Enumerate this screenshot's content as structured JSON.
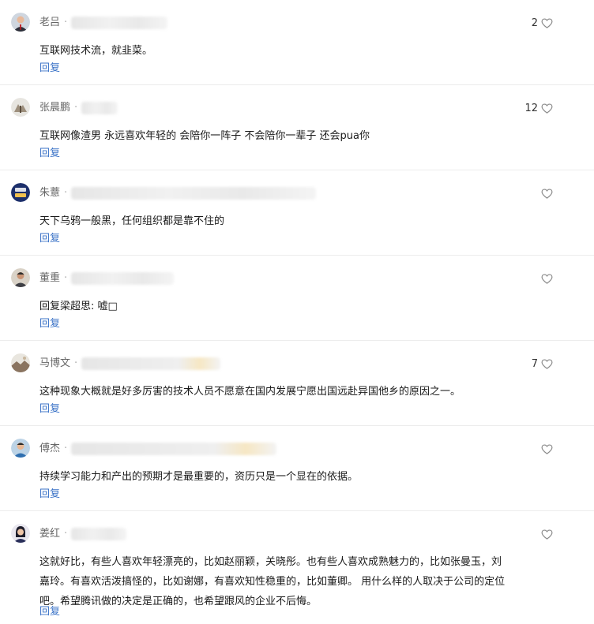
{
  "reply_label": "回复",
  "comments": [
    {
      "name": "老吕",
      "likes": "2",
      "text": "互联网技术流，就韭菜。",
      "avatar": "man-red-tie"
    },
    {
      "name": "张晨鹏",
      "likes": "12",
      "text": "互联网像渣男 永远喜欢年轻的 会陪你一阵子 不会陪你一辈子 还会pua你",
      "avatar": "snow-scene"
    },
    {
      "name": "朱薏",
      "likes": "",
      "text": "天下乌鸦一般黑，任何组织都是靠不住的",
      "avatar": "badge-logo"
    },
    {
      "name": "董重",
      "likes": "",
      "text": "回复梁超思: 嘘□",
      "avatar": "man-portrait"
    },
    {
      "name": "马博文",
      "likes": "7",
      "text": "这种现象大概就是好多厉害的技术人员不愿意在国内发展宁愿出国远赴异国他乡的原因之一。",
      "avatar": "landscape"
    },
    {
      "name": "傅杰",
      "likes": "",
      "text": "持续学习能力和产出的预期才是最重要的，资历只是一个显在的依据。",
      "avatar": "man-blue"
    },
    {
      "name": "姜红",
      "likes": "",
      "text": "这就好比，有些人喜欢年轻漂亮的，比如赵丽颖，关晓彤。也有些人喜欢成熟魅力的，比如张曼玉，刘嘉玲。有喜欢活泼搞怪的，比如谢娜，有喜欢知性稳重的，比如董卿。 用什么样的人取决于公司的定位吧。希望腾讯做的决定是正确的，也希望跟风的企业不后悔。",
      "avatar": "woman-portrait"
    }
  ]
}
